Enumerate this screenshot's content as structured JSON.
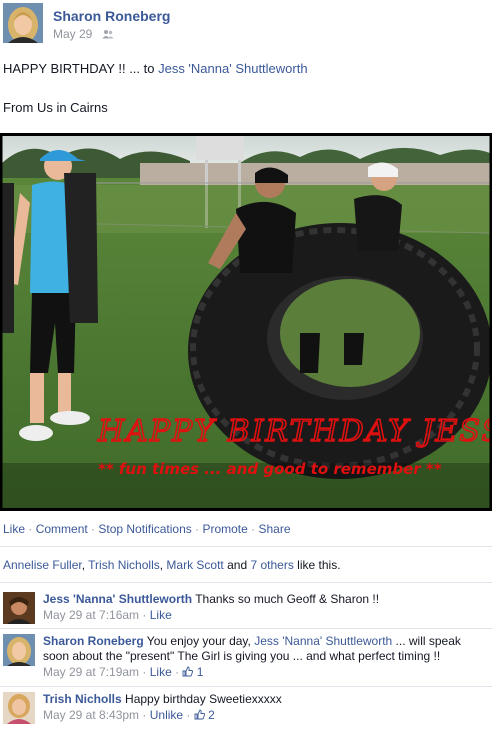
{
  "post": {
    "author": "Sharon Roneberg",
    "date": "May 29",
    "audience_icon": "friends-icon",
    "text_prefix": "HAPPY BIRTHDAY !! ... to ",
    "tagged": "Jess 'Nanna' Shuttleworth",
    "text_line2": "From Us in Cairns"
  },
  "photo": {
    "overlay_title": "HAPPY BIRTHDAY JESS",
    "overlay_subtitle": "** fun times ... and good to remember **",
    "colors": {
      "overlay_red": "#e01010",
      "grass": "#4f7a32"
    }
  },
  "actions": {
    "like": "Like",
    "comment": "Comment",
    "stop_notifications": "Stop Notifications",
    "promote": "Promote",
    "share": "Share",
    "separator": " · "
  },
  "likes": {
    "names": [
      "Annelise Fuller",
      "Trish Nicholls",
      "Mark Scott"
    ],
    "and": " and ",
    "others": "7 others",
    "suffix": " like this.",
    "comma": ", "
  },
  "comments": [
    {
      "name": "Jess 'Nanna' Shuttleworth",
      "text": " Thanks so much Geoff & Sharon !!",
      "time": "May 29 at 7:16am",
      "action": "Like",
      "like_count": ""
    },
    {
      "name": "Sharon Roneberg",
      "text_a": " You enjoy your day, ",
      "mention": "Jess 'Nanna' Shuttleworth",
      "text_b": " ... will speak soon about the \"present\" The Girl is giving you ... and what perfect timing !!",
      "time": "May 29 at 7:19am",
      "action": "Like",
      "like_count": "1"
    },
    {
      "name": "Trish Nicholls",
      "text": " Happy birthday Sweetiexxxxx",
      "time": "May 29 at 8:43pm",
      "action": "Unlike",
      "like_count": "2"
    }
  ],
  "colors": {
    "link": "#3b5998",
    "meta": "#90949c",
    "divider": "#e1e4ea"
  }
}
